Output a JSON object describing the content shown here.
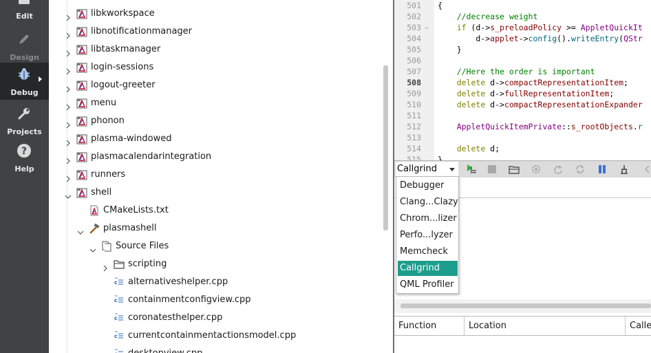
{
  "modebar": {
    "modes": [
      {
        "label": "Edit",
        "icon": "edit-icon",
        "state": "normal"
      },
      {
        "label": "Design",
        "icon": "design-icon",
        "state": "disabled"
      },
      {
        "label": "Debug",
        "icon": "debug-icon",
        "state": "active"
      },
      {
        "label": "Projects",
        "icon": "projects-icon",
        "state": "normal"
      },
      {
        "label": "Help",
        "icon": "help-icon",
        "state": "normal"
      }
    ]
  },
  "tree": {
    "items": [
      {
        "label": "libkworkspace",
        "icon": "project-icon",
        "expanded": false
      },
      {
        "label": "libnotificationmanager",
        "icon": "project-icon",
        "expanded": false
      },
      {
        "label": "libtaskmanager",
        "icon": "project-icon",
        "expanded": false
      },
      {
        "label": "login-sessions",
        "icon": "project-icon",
        "expanded": false
      },
      {
        "label": "logout-greeter",
        "icon": "project-icon",
        "expanded": false
      },
      {
        "label": "menu",
        "icon": "project-icon",
        "expanded": false
      },
      {
        "label": "phonon",
        "icon": "project-icon",
        "expanded": false
      },
      {
        "label": "plasma-windowed",
        "icon": "project-icon",
        "expanded": false
      },
      {
        "label": "plasmacalendarintegration",
        "icon": "project-icon",
        "expanded": false
      },
      {
        "label": "runners",
        "icon": "project-icon",
        "expanded": false
      },
      {
        "label": "shell",
        "icon": "project-icon",
        "expanded": true
      },
      {
        "label": "CMakeLists.txt",
        "icon": "cmake-file-icon",
        "expanded": null
      },
      {
        "label": "plasmashell",
        "icon": "build-target-icon",
        "expanded": true
      },
      {
        "label": "Source Files",
        "icon": "source-folder-icon",
        "expanded": true
      },
      {
        "label": "scripting",
        "icon": "folder-icon",
        "expanded": false
      },
      {
        "label": "alternativeshelper.cpp",
        "icon": "cpp-file-icon",
        "expanded": null
      },
      {
        "label": "containmentconfigview.cpp",
        "icon": "cpp-file-icon",
        "expanded": null
      },
      {
        "label": "coronatesthelper.cpp",
        "icon": "cpp-file-icon",
        "expanded": null
      },
      {
        "label": "currentcontainmentactionsmodel.cpp",
        "icon": "cpp-file-icon",
        "expanded": null
      },
      {
        "label": "desktopview.cpp",
        "icon": "cpp-file-icon",
        "expanded": null
      }
    ]
  },
  "editor": {
    "current_line": "508",
    "lines": [
      {
        "n": "501",
        "fold": "",
        "html": "{"
      },
      {
        "n": "502",
        "fold": "",
        "html": "    <span class=\"cm\">//decrease weight</span>"
      },
      {
        "n": "503",
        "fold": "⌵",
        "html": "    <span class=\"kw\">if</span> (d-&gt;<span class=\"mem\">s_preloadPolicy</span> &gt;= <span class=\"ty\">AppletQuickIt</span>"
      },
      {
        "n": "504",
        "fold": "",
        "html": "        d-&gt;<span class=\"mem\">applet</span>-&gt;<span class=\"fn\">config</span>().<span class=\"fn\">writeEntry</span>(<span class=\"ty\">QStr</span>"
      },
      {
        "n": "505",
        "fold": "",
        "html": "    }"
      },
      {
        "n": "506",
        "fold": "",
        "html": ""
      },
      {
        "n": "507",
        "fold": "",
        "html": "    <span class=\"cm\">//Here the order is important</span>"
      },
      {
        "n": "508",
        "fold": "",
        "html": "    <span class=\"kw\">delete</span> d-&gt;<span class=\"mem\">compactRepresentationItem</span>;"
      },
      {
        "n": "509",
        "fold": "",
        "html": "    <span class=\"kw\">delete</span> d-&gt;<span class=\"mem\">fullRepresentationItem</span>;"
      },
      {
        "n": "510",
        "fold": "",
        "html": "    <span class=\"kw\">delete</span> d-&gt;<span class=\"mem\">compactRepresentationExpander</span>"
      },
      {
        "n": "511",
        "fold": "",
        "html": ""
      },
      {
        "n": "512",
        "fold": "",
        "html": "    <span class=\"ty\">AppletQuickItemPrivate</span>::<span class=\"mem\">s_rootObjects</span>.<span class=\"fn\">r</span>"
      },
      {
        "n": "513",
        "fold": "",
        "html": ""
      },
      {
        "n": "514",
        "fold": "",
        "html": "    <span class=\"kw\">delete</span> d;"
      },
      {
        "n": "515",
        "fold": "",
        "html": "}"
      }
    ]
  },
  "toolbar": {
    "tool_combo_value": "Callgrind",
    "buttons": [
      "start-analysis-icon",
      "stop-icon",
      "open-icon",
      "settings-icon",
      "redo-icon",
      "reload-icon",
      "pause-icon",
      "discard-icon",
      "arrow-left-icon"
    ]
  },
  "dropdown": {
    "options": [
      "Debugger",
      "Clang...Clazy",
      "Chrom...lizer",
      "Perfo...lyzer",
      "Memcheck",
      "Callgrind",
      "QML Profiler"
    ],
    "selected": "Callgrind"
  },
  "results_table": {
    "columns": [
      "Function",
      "Location",
      "Calle"
    ]
  },
  "colors": {
    "modebar_bg": "#404244",
    "modebar_active": "#262728",
    "selection": "#1d9d8c"
  }
}
